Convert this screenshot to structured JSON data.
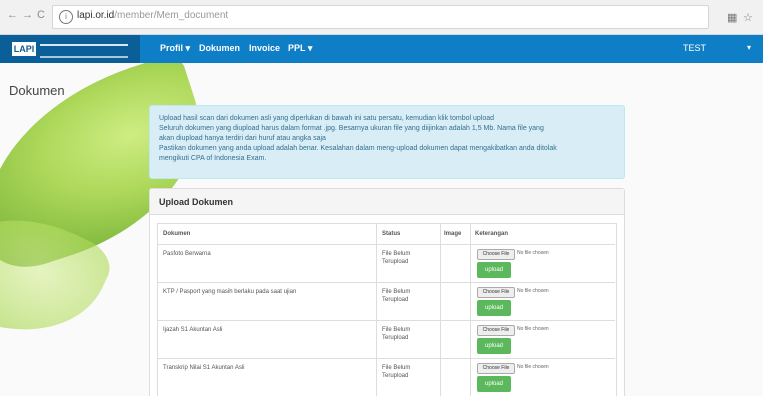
{
  "browser": {
    "back": "←",
    "forward": "→",
    "reload": "C",
    "address_domain": "lapi.or.id",
    "address_path": "/member/Mem_document",
    "ext_icon": "puzzle-icon",
    "star_icon": "☆"
  },
  "navbar": {
    "logo_text": "LAPI",
    "menu": [
      "Profil ▾",
      "Dokumen",
      "Invoice",
      "PPL ▾"
    ],
    "user": "TEST",
    "user_caret": "▾",
    "color": "#0e7ec6"
  },
  "page_title": "Dokumen",
  "info": {
    "lines": [
      "Upload hasil scan dari dokumen asli yang diperlukan di bawah ini satu persatu, kemudian klik tombol upload",
      "Seluruh dokumen yang diupload harus dalam format .jpg. Besarnya ukuran file yang diijinkan adalah 1,5 Mb. Nama file yang",
      "akan diupload hanya terdiri dari huruf atau angka saja",
      "Pastikan dokumen yang anda upload adalah benar. Kesalahan dalam meng-upload dokumen dapat mengakibatkan anda ditolak",
      "mengikuti CPA of Indonesia Exam."
    ]
  },
  "panel": {
    "title": "Upload Dokumen",
    "headers": [
      "Dokumen",
      "Status",
      "Image",
      "Keterangan"
    ],
    "choose_label": "Choose File",
    "no_file_label": "No file chosen",
    "upload_label": "upload",
    "rows": [
      {
        "dokumen": "Pasfoto Berwarna",
        "status_1": "File Belum",
        "status_2": "Terupload"
      },
      {
        "dokumen": "KTP / Pasport yang masih berlaku pada saat ujian",
        "status_1": "File Belum",
        "status_2": "Terupload"
      },
      {
        "dokumen": "Ijazah S1 Akuntan Asli",
        "status_1": "File Belum",
        "status_2": "Terupload"
      },
      {
        "dokumen": "Transkrip Nilai S1 Akuntan Asli",
        "status_1": "File Belum",
        "status_2": "Terupload"
      }
    ]
  }
}
